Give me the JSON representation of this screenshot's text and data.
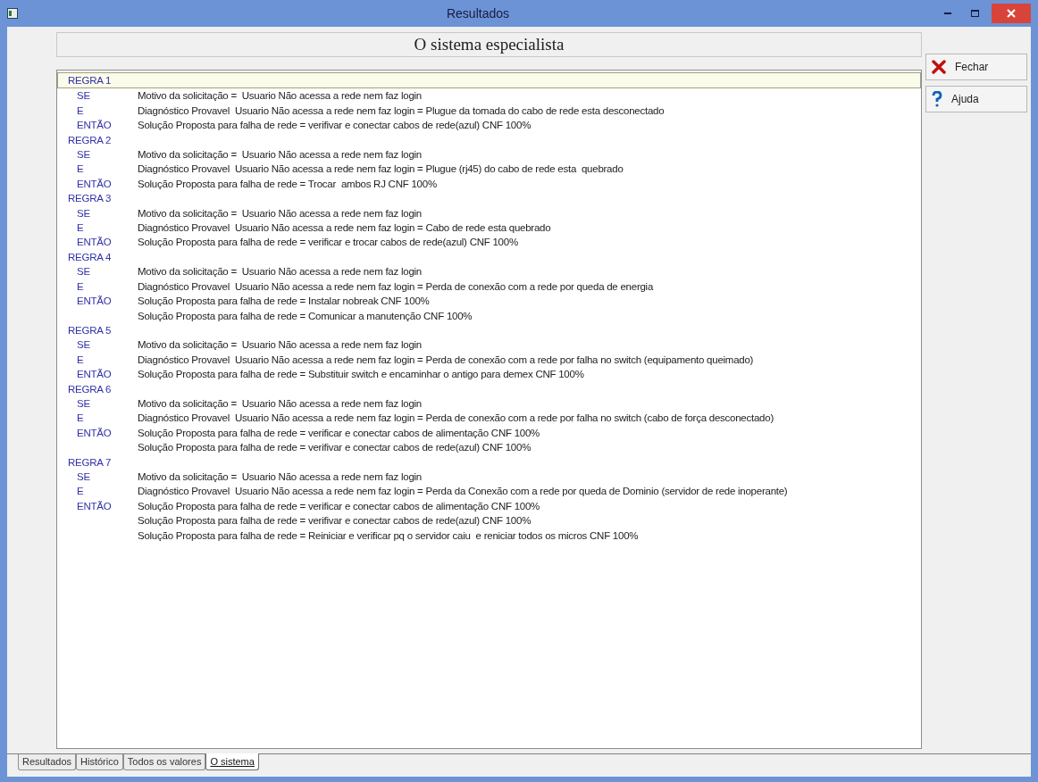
{
  "window": {
    "title": "Resultados"
  },
  "header": {
    "title": "O sistema especialista"
  },
  "buttons": [
    {
      "kind": "close",
      "label": "Fechar"
    },
    {
      "kind": "help",
      "label": "Ajuda"
    }
  ],
  "rules": [
    {
      "title": "REGRA 1",
      "focused": true,
      "lines": [
        {
          "keyword": "SE",
          "text": "Motivo da solicitação =  Usuario Não acessa a rede nem faz login"
        },
        {
          "keyword": "E",
          "text": "Diagnóstico Provavel  Usuario Não acessa a rede nem faz login = Plugue da tomada do cabo de rede esta desconectado"
        },
        {
          "keyword": "ENTÃO",
          "text": "Solução Proposta para falha de rede = verifivar e conectar cabos de rede(azul) CNF 100%"
        }
      ]
    },
    {
      "title": "REGRA 2",
      "focused": false,
      "lines": [
        {
          "keyword": "SE",
          "text": "Motivo da solicitação =  Usuario Não acessa a rede nem faz login"
        },
        {
          "keyword": "E",
          "text": "Diagnóstico Provavel  Usuario Não acessa a rede nem faz login = Plugue (rj45) do cabo de rede esta  quebrado"
        },
        {
          "keyword": "ENTÃO",
          "text": "Solução Proposta para falha de rede = Trocar  ambos RJ CNF 100%"
        }
      ]
    },
    {
      "title": "REGRA 3",
      "focused": false,
      "lines": [
        {
          "keyword": "SE",
          "text": "Motivo da solicitação =  Usuario Não acessa a rede nem faz login"
        },
        {
          "keyword": "E",
          "text": "Diagnóstico Provavel  Usuario Não acessa a rede nem faz login = Cabo de rede esta quebrado"
        },
        {
          "keyword": "ENTÃO",
          "text": "Solução Proposta para falha de rede = verificar e trocar cabos de rede(azul) CNF 100%"
        }
      ]
    },
    {
      "title": "REGRA 4",
      "focused": false,
      "lines": [
        {
          "keyword": "SE",
          "text": "Motivo da solicitação =  Usuario Não acessa a rede nem faz login"
        },
        {
          "keyword": "E",
          "text": "Diagnóstico Provavel  Usuario Não acessa a rede nem faz login = Perda de conexão com a rede por queda de energia"
        },
        {
          "keyword": "ENTÃO",
          "text": "Solução Proposta para falha de rede = Instalar nobreak CNF 100%"
        },
        {
          "text": "Solução Proposta para falha de rede = Comunicar a manutenção CNF 100%"
        }
      ]
    },
    {
      "title": "REGRA 5",
      "focused": false,
      "lines": [
        {
          "keyword": "SE",
          "text": "Motivo da solicitação =  Usuario Não acessa a rede nem faz login"
        },
        {
          "keyword": "E",
          "text": "Diagnóstico Provavel  Usuario Não acessa a rede nem faz login = Perda de conexão com a rede por falha no switch (equipamento queimado)"
        },
        {
          "keyword": "ENTÃO",
          "text": "Solução Proposta para falha de rede = Substituir switch e encaminhar o antigo para demex CNF 100%"
        }
      ]
    },
    {
      "title": "REGRA 6",
      "focused": false,
      "lines": [
        {
          "keyword": "SE",
          "text": "Motivo da solicitação =  Usuario Não acessa a rede nem faz login"
        },
        {
          "keyword": "E",
          "text": "Diagnóstico Provavel  Usuario Não acessa a rede nem faz login = Perda de conexão com a rede por falha no switch (cabo de força desconectado)"
        },
        {
          "keyword": "ENTÃO",
          "text": "Solução Proposta para falha de rede = verificar e conectar cabos de alimentação CNF 100%"
        },
        {
          "text": "Solução Proposta para falha de rede = verifivar e conectar cabos de rede(azul) CNF 100%"
        }
      ]
    },
    {
      "title": "REGRA 7",
      "focused": false,
      "lines": [
        {
          "keyword": "SE",
          "text": "Motivo da solicitação =  Usuario Não acessa a rede nem faz login"
        },
        {
          "keyword": "E",
          "text": "Diagnóstico Provavel  Usuario Não acessa a rede nem faz login = Perda da Conexão com a rede por queda de Dominio (servidor de rede inoperante)"
        },
        {
          "keyword": "ENTÃO",
          "text": "Solução Proposta para falha de rede = verificar e conectar cabos de alimentação CNF 100%"
        },
        {
          "text": "Solução Proposta para falha de rede = verifivar e conectar cabos de rede(azul) CNF 100%"
        },
        {
          "text": "Solução Proposta para falha de rede = Reiniciar e verificar pq o servidor caiu  e reniciar todos os micros CNF 100%"
        }
      ]
    }
  ],
  "tabs": [
    {
      "label": "Resultados",
      "selected": false
    },
    {
      "label": "Histórico",
      "selected": false
    },
    {
      "label": "Todos os valores",
      "selected": false
    },
    {
      "label": "O sistema",
      "selected": true
    }
  ]
}
